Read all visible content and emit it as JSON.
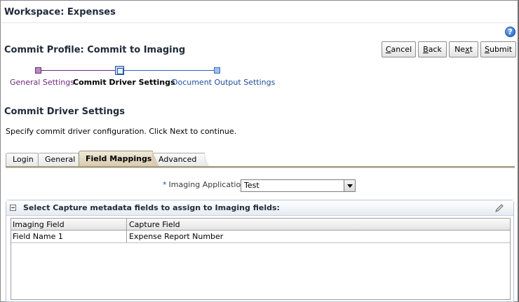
{
  "workspace": {
    "title": "Workspace: Expenses"
  },
  "help": {
    "icon": "help-icon",
    "glyph": "?"
  },
  "profile": {
    "title": "Commit Profile: Commit to Imaging"
  },
  "buttons": {
    "cancel": "Cancel",
    "back": "Back",
    "next": "Next",
    "submit": "Submit"
  },
  "train": {
    "steps": [
      {
        "label": "General Settings",
        "state": "visited"
      },
      {
        "label": "Commit Driver Settings",
        "state": "current"
      },
      {
        "label": "Document Output Settings",
        "state": "unvisited"
      }
    ]
  },
  "section": {
    "title": "Commit Driver Settings",
    "instruction": "Specify commit driver configuration. Click Next to continue."
  },
  "tabs": [
    {
      "label": "Login",
      "selected": false
    },
    {
      "label": "General",
      "selected": false
    },
    {
      "label": "Field Mappings",
      "selected": true
    },
    {
      "label": "Advanced",
      "selected": false
    }
  ],
  "imaging_app": {
    "required_marker": "*",
    "label": "Imaging Application",
    "value": "Test"
  },
  "mapping_panel": {
    "title": "Select Capture metadata fields to assign to Imaging fields:",
    "columns": [
      "Imaging Field",
      "Capture Field"
    ],
    "rows": [
      {
        "imaging_field": "Field Name 1",
        "capture_field": "Expense Report Number"
      }
    ]
  },
  "colors": {
    "accent_purple": "#6a2a7a",
    "accent_blue": "#1c4e9c",
    "tab_selected": "#d8ccb0"
  }
}
